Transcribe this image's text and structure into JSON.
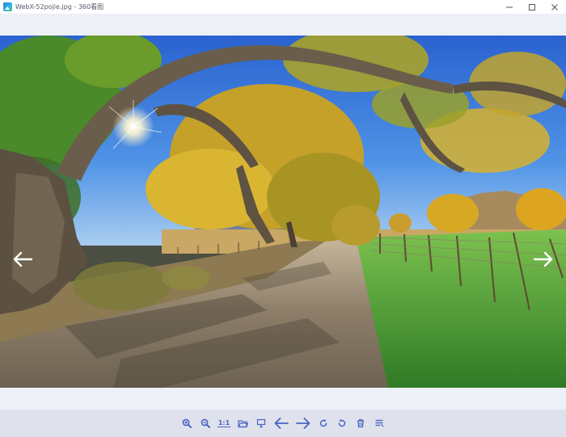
{
  "window": {
    "title": "WebX-52pojie.jpg - 360看图",
    "controls": [
      "minimize",
      "maximize",
      "close"
    ]
  },
  "viewer": {
    "image_description_icon": "landscape-photo",
    "prev_icon": "arrow-left-icon",
    "next_icon": "arrow-right-icon"
  },
  "toolbar": {
    "items": [
      {
        "name": "zoom-in",
        "icon": "zoom-in-icon"
      },
      {
        "name": "zoom-out",
        "icon": "zoom-out-icon"
      },
      {
        "name": "actual-size",
        "label": "1:1"
      },
      {
        "name": "open-folder",
        "icon": "folder-icon"
      },
      {
        "name": "slideshow",
        "icon": "slideshow-icon"
      },
      {
        "name": "previous",
        "icon": "arrow-left-icon"
      },
      {
        "name": "next",
        "icon": "arrow-right-icon"
      },
      {
        "name": "rotate-right",
        "icon": "rotate-right-icon"
      },
      {
        "name": "rotate-left",
        "icon": "rotate-left-icon"
      },
      {
        "name": "delete",
        "icon": "trash-icon"
      },
      {
        "name": "more",
        "icon": "menu-icon"
      }
    ]
  },
  "colors": {
    "accent": "#4a62c4",
    "background": "#eef0f7",
    "toolbar": "#dfe2ec",
    "sky": "#2f6fd8",
    "foliage": "#d9b22a",
    "grass": "#4aa33a"
  }
}
